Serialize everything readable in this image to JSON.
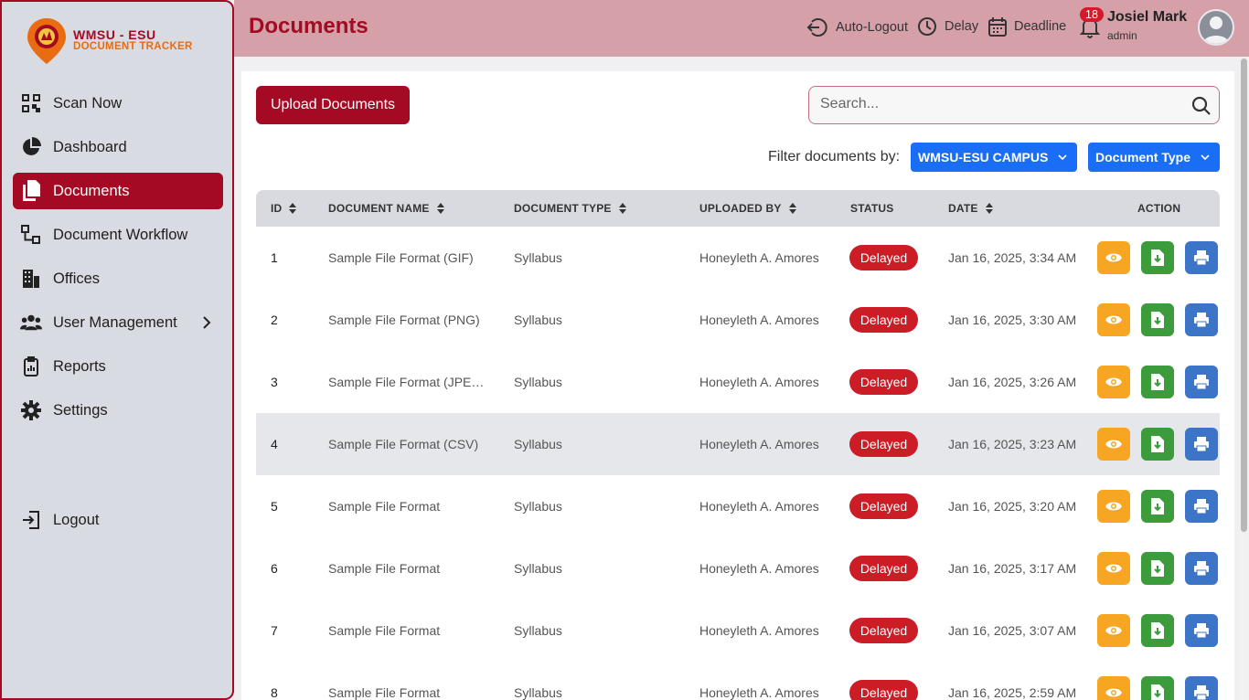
{
  "brand": {
    "line1": "WMSU - ESU",
    "line2": "DOCUMENT TRACKER"
  },
  "sidebar": {
    "items": [
      {
        "label": "Scan Now",
        "icon": "qr-code-icon"
      },
      {
        "label": "Dashboard",
        "icon": "pie-chart-icon"
      },
      {
        "label": "Documents",
        "icon": "documents-icon",
        "active": true
      },
      {
        "label": "Document Workflow",
        "icon": "workflow-icon"
      },
      {
        "label": "Offices",
        "icon": "building-icon"
      },
      {
        "label": "User Management",
        "icon": "users-icon",
        "has_submenu": true
      },
      {
        "label": "Reports",
        "icon": "clipboard-icon"
      },
      {
        "label": "Settings",
        "icon": "gear-icon"
      }
    ],
    "logout_label": "Logout"
  },
  "header": {
    "title": "Documents",
    "auto_logout": "Auto-Logout",
    "delay": "Delay",
    "deadline": "Deadline",
    "notification_count": "18",
    "user_name": "Josiel Mark",
    "user_role": "admin"
  },
  "toolbar": {
    "upload_label": "Upload Documents",
    "search_placeholder": "Search...",
    "filter_label": "Filter documents by:",
    "campus_filter": "WMSU-ESU CAMPUS",
    "type_filter": "Document Type"
  },
  "table": {
    "columns": [
      "ID",
      "DOCUMENT NAME",
      "DOCUMENT TYPE",
      "UPLOADED BY",
      "STATUS",
      "DATE",
      "ACTION"
    ],
    "rows": [
      {
        "id": "1",
        "name": "Sample File Format (GIF)",
        "type": "Syllabus",
        "uploaded_by": "Honeyleth A. Amores",
        "status": "Delayed",
        "date": "Jan 16, 2025, 3:34 AM"
      },
      {
        "id": "2",
        "name": "Sample File Format (PNG)",
        "type": "Syllabus",
        "uploaded_by": "Honeyleth A. Amores",
        "status": "Delayed",
        "date": "Jan 16, 2025, 3:30 AM"
      },
      {
        "id": "3",
        "name": "Sample File Format (JPE…",
        "type": "Syllabus",
        "uploaded_by": "Honeyleth A. Amores",
        "status": "Delayed",
        "date": "Jan 16, 2025, 3:26 AM"
      },
      {
        "id": "4",
        "name": "Sample File Format (CSV)",
        "type": "Syllabus",
        "uploaded_by": "Honeyleth A. Amores",
        "status": "Delayed",
        "date": "Jan 16, 2025, 3:23 AM"
      },
      {
        "id": "5",
        "name": "Sample File Format",
        "type": "Syllabus",
        "uploaded_by": "Honeyleth A. Amores",
        "status": "Delayed",
        "date": "Jan 16, 2025, 3:20 AM"
      },
      {
        "id": "6",
        "name": "Sample File Format",
        "type": "Syllabus",
        "uploaded_by": "Honeyleth A. Amores",
        "status": "Delayed",
        "date": "Jan 16, 2025, 3:17 AM"
      },
      {
        "id": "7",
        "name": "Sample File Format",
        "type": "Syllabus",
        "uploaded_by": "Honeyleth A. Amores",
        "status": "Delayed",
        "date": "Jan 16, 2025, 3:07 AM"
      },
      {
        "id": "8",
        "name": "Sample File Format",
        "type": "Syllabus",
        "uploaded_by": "Honeyleth A. Amores",
        "status": "Delayed",
        "date": "Jan 16, 2025, 2:59 AM"
      }
    ],
    "actions": [
      "view-icon",
      "download-icon",
      "print-icon"
    ]
  },
  "colors": {
    "brand_red": "#a40a24",
    "header_bg": "#d5a0a8",
    "dropdown_blue": "#1a6ef5",
    "status_delayed": "#cc1d26",
    "view_orange": "#f6a623",
    "download_green": "#3c9c3c",
    "print_blue": "#3c74c7"
  }
}
